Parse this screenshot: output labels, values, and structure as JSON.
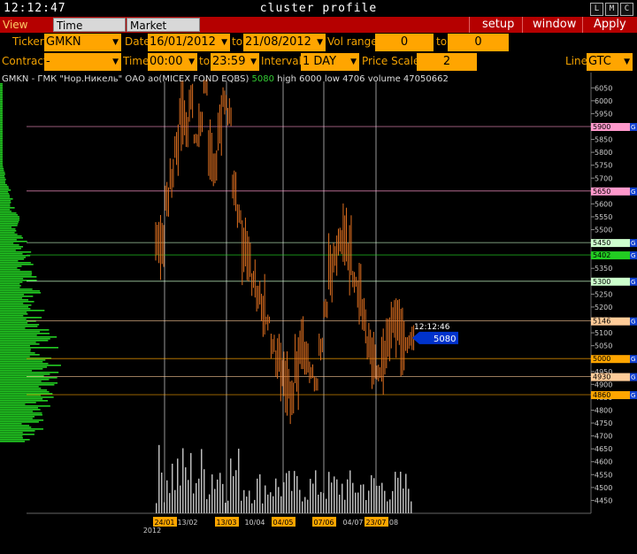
{
  "window": {
    "clock": "12:12:47",
    "title": "cluster profile",
    "buttons": [
      "L",
      "M",
      "C"
    ]
  },
  "menu": {
    "tabs": [
      "View DOM",
      "Time Interval",
      "Market Watch"
    ],
    "setup": "setup",
    "window": "window",
    "apply": "Apply"
  },
  "controls": {
    "ticker_label": "Ticker",
    "ticker_value": "GMKN",
    "date_label": "Date",
    "date_from": "16/01/2012",
    "to1": "to",
    "date_to": "21/08/2012",
    "vol_label": "Vol range",
    "vol_from": "0",
    "to2": "to",
    "vol_to": "0",
    "contract_label": "Contract",
    "contract_value": "-",
    "time_label": "Time",
    "time_from": "00:00",
    "to3": "to",
    "time_to": "23:59",
    "interval_label": "Interval",
    "interval_value": "1 DAY",
    "price_scale_label": "Price Scale",
    "price_scale_value": "2",
    "line_label": "Line",
    "line_value": "GTC"
  },
  "info": {
    "name": "GMKN - ГМК \"Нор.Никель\" ОАО ао(MICEX FOND EQBS)",
    "last": "5080",
    "high": "high 6000",
    "low": "low 4706",
    "volume": "volume 47050662"
  },
  "colors": {
    "accent": "#ffa500",
    "menu_red": "#b50000",
    "candle": "#e07020",
    "profile": "#22cc22",
    "current_price": "#0033cc"
  },
  "chart_data": {
    "type": "line",
    "ylim": [
      4400,
      6075
    ],
    "y_ticks": [
      6050,
      6000,
      5950,
      5900,
      5850,
      5800,
      5750,
      5700,
      5650,
      5600,
      5550,
      5500,
      5450,
      5400,
      5350,
      5300,
      5250,
      5200,
      5150,
      5100,
      5050,
      5000,
      4950,
      4900,
      4850,
      4800,
      4750,
      4700,
      4650,
      4600,
      4550,
      4500,
      4450
    ],
    "current_price": {
      "time": "12:12:46",
      "value": "5080",
      "price": 5080
    },
    "levels": [
      {
        "label": "5900",
        "price": 5900,
        "color": "#ff99cc"
      },
      {
        "label": "5650",
        "price": 5650,
        "color": "#ff99cc"
      },
      {
        "label": "5450",
        "price": 5450,
        "color": "#ccffcc"
      },
      {
        "label": "5402",
        "price": 5402,
        "color": "#22cc22"
      },
      {
        "label": "5300",
        "price": 5300,
        "color": "#ccffcc"
      },
      {
        "label": "5146",
        "price": 5146,
        "color": "#ffcc99"
      },
      {
        "label": "5000",
        "price": 5000,
        "color": "#ffa500"
      },
      {
        "label": "4930",
        "price": 4930,
        "color": "#ffcc99"
      },
      {
        "label": "4860",
        "price": 4860,
        "color": "#ffa500"
      }
    ],
    "x_labels": [
      {
        "label": "24/01",
        "hl": true
      },
      {
        "label": "13/02",
        "hl": false
      },
      {
        "label": "13/03",
        "hl": true
      },
      {
        "label": "10/04",
        "hl": false
      },
      {
        "label": "04/05",
        "hl": true
      },
      {
        "label": "07/06",
        "hl": true
      },
      {
        "label": "04/07",
        "hl": false
      },
      {
        "label": "23/07",
        "hl": true
      },
      {
        "label": "08",
        "hl": false
      }
    ],
    "year_label": "2012",
    "price_path": [
      [
        5450,
        5420,
        5620,
        5700,
        5820,
        5950,
        5900,
        6000,
        5850,
        5920,
        6050,
        5800,
        5750,
        5900,
        6000,
        5950,
        5650,
        5550,
        5420,
        5400,
        5300,
        5250,
        5200,
        5150,
        5050,
        5000,
        4950,
        4900,
        4850,
        4950,
        5050,
        5000,
        4950,
        4900,
        5050,
        5200,
        5350,
        5400,
        5450,
        5480,
        5400,
        5300,
        5250,
        5150,
        5050,
        4980,
        4950,
        5000,
        5100,
        5150,
        5120,
        5080,
        5060,
        5080
      ]
    ]
  }
}
